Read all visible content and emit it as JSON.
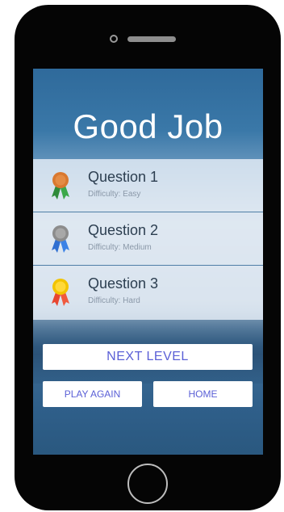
{
  "screen": {
    "title": "Good Job"
  },
  "questions": [
    {
      "title": "Question 1",
      "difficulty": "Difficulty: Easy",
      "medal": "bronze-medal-icon"
    },
    {
      "title": "Question 2",
      "difficulty": "Difficulty: Medium",
      "medal": "silver-medal-icon"
    },
    {
      "title": "Question 3",
      "difficulty": "Difficulty: Hard",
      "medal": "gold-medal-icon"
    }
  ],
  "buttons": {
    "next_level": "NEXT LEVEL",
    "play_again": "PLAY AGAIN",
    "home": "HOME"
  },
  "colors": {
    "accent_text": "#5a5fd6",
    "bronze": "#d9782f",
    "silver": "#9a9a9a",
    "gold": "#f2c400"
  }
}
